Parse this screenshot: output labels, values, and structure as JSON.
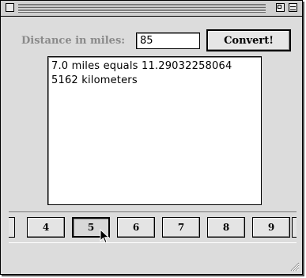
{
  "window": {
    "close_icon": "close-box-icon",
    "zoom_icon": "zoom-box-icon",
    "collapse_icon": "collapse-box-icon"
  },
  "form": {
    "miles_label": "Distance in miles:",
    "miles_value": "85",
    "convert_label": "Convert!"
  },
  "output": {
    "text": "7.0 miles equals 11.29032258064 5162 kilometers"
  },
  "number_buttons": [
    {
      "label": "4",
      "pressed": false
    },
    {
      "label": "5",
      "pressed": true
    },
    {
      "label": "6",
      "pressed": false
    },
    {
      "label": "7",
      "pressed": false
    },
    {
      "label": "8",
      "pressed": false
    },
    {
      "label": "9",
      "pressed": false
    }
  ],
  "colors": {
    "window_bg": "#dcdcdc",
    "label_gray": "#8a8a8a"
  }
}
